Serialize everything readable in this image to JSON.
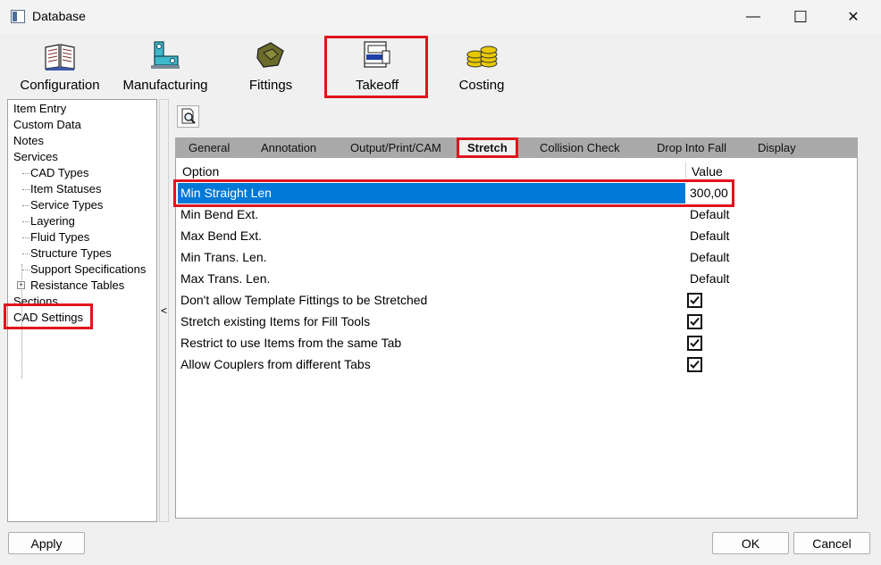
{
  "window": {
    "title": "Database",
    "controls": {
      "minimize": "—",
      "maximize": "☐",
      "close": "✕"
    }
  },
  "ribbon": {
    "items": [
      {
        "label": "Configuration",
        "icon": "book-icon"
      },
      {
        "label": "Manufacturing",
        "icon": "machine-icon"
      },
      {
        "label": "Fittings",
        "icon": "fitting-icon"
      },
      {
        "label": "Takeoff",
        "icon": "takeoff-icon",
        "selected": true
      },
      {
        "label": "Costing",
        "icon": "coins-icon"
      }
    ]
  },
  "tree": {
    "items": [
      {
        "label": "Item Entry"
      },
      {
        "label": "Custom Data"
      },
      {
        "label": "Notes"
      },
      {
        "label": "Services"
      },
      {
        "label": "CAD Types"
      },
      {
        "label": "Item Statuses"
      },
      {
        "label": "Service Types"
      },
      {
        "label": "Layering"
      },
      {
        "label": "Fluid Types"
      },
      {
        "label": "Structure Types"
      },
      {
        "label": "Support Specifications"
      },
      {
        "label": "Resistance Tables"
      },
      {
        "label": "Sections"
      },
      {
        "label": "CAD Settings",
        "selected": true
      }
    ],
    "expand_glyph": "+"
  },
  "splitter": {
    "label": "<"
  },
  "tabs": [
    {
      "label": "General"
    },
    {
      "label": "Annotation"
    },
    {
      "label": "Output/Print/CAM"
    },
    {
      "label": "Stretch",
      "active": true
    },
    {
      "label": "Collision Check"
    },
    {
      "label": "Drop Into Fall"
    },
    {
      "label": "Display"
    }
  ],
  "grid": {
    "columns": {
      "option": "Option",
      "value": "Value"
    },
    "rows": [
      {
        "option": "Min Straight Len",
        "value": "300,00",
        "selected": true
      },
      {
        "option": "Min Bend Ext.",
        "value": "Default"
      },
      {
        "option": "Max Bend Ext.",
        "value": "Default"
      },
      {
        "option": "Min Trans. Len.",
        "value": "Default"
      },
      {
        "option": "Max Trans. Len.",
        "value": "Default"
      },
      {
        "option": "Don't allow Template Fittings to be Stretched",
        "checked": true
      },
      {
        "option": "Stretch existing Items for Fill Tools",
        "checked": true
      },
      {
        "option": "Restrict to use Items from the same Tab",
        "checked": true
      },
      {
        "option": "Allow Couplers from different Tabs",
        "checked": true
      }
    ]
  },
  "buttons": {
    "apply": "Apply",
    "ok": "OK",
    "cancel": "Cancel"
  },
  "colors": {
    "highlight": "#e0141c",
    "selection": "#0078d7",
    "tabstrip": "#a9a9a9"
  }
}
